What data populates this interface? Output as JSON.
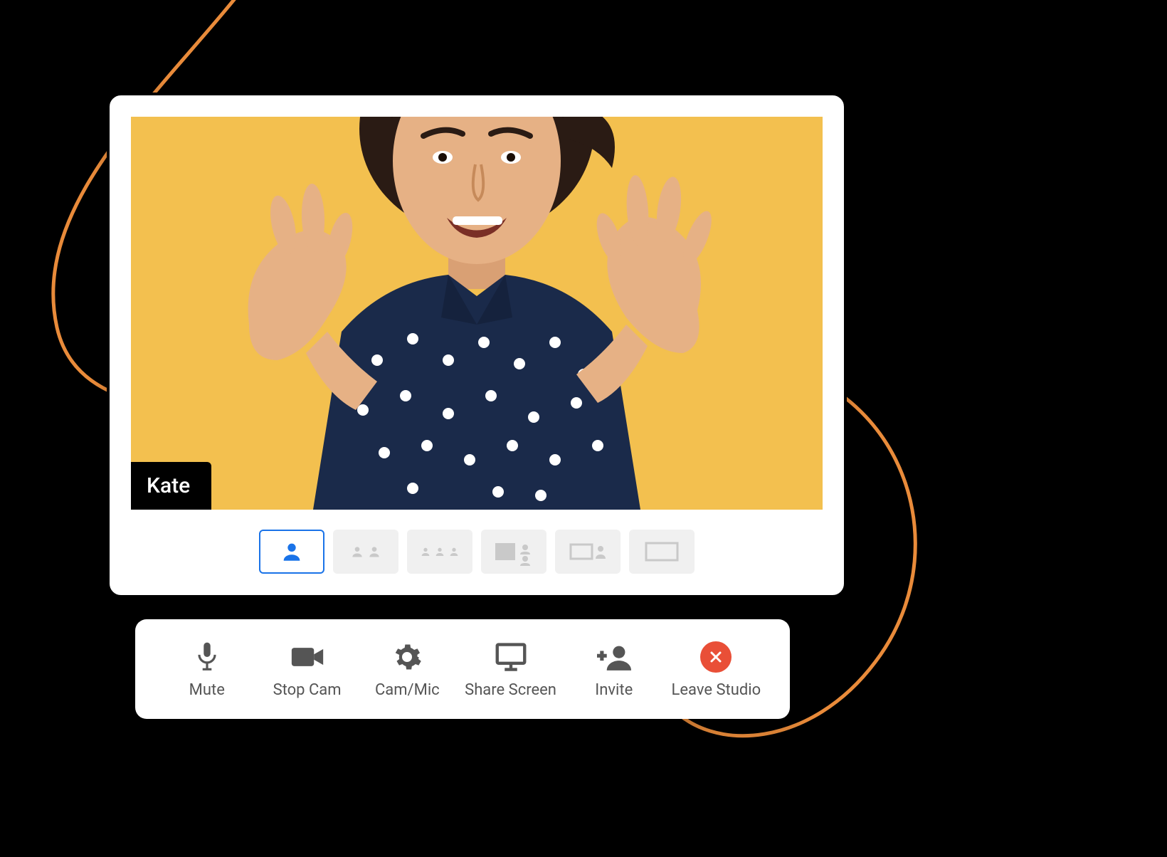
{
  "video": {
    "participant_name": "Kate",
    "background_color": "#f3c04f"
  },
  "layouts": {
    "active_index": 0,
    "tiles": [
      "single",
      "two-up",
      "three-up",
      "one-plus-two",
      "side-by-side",
      "full"
    ]
  },
  "controls": {
    "mute": {
      "label": "Mute"
    },
    "stop": {
      "label": "Stop Cam"
    },
    "cammic": {
      "label": "Cam/Mic"
    },
    "share": {
      "label": "Share Screen"
    },
    "invite": {
      "label": "Invite"
    },
    "leave": {
      "label": "Leave Studio",
      "color": "#e94f37"
    }
  }
}
